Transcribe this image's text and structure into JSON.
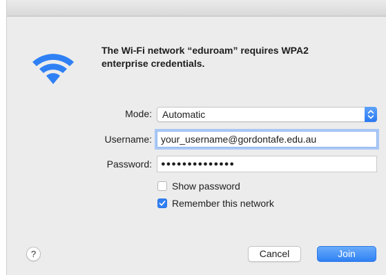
{
  "dialog": {
    "message": "The Wi-Fi network “eduroam” requires WPA2 enterprise credentials.",
    "icon": "wifi-icon",
    "accent_color": "#2f80f4"
  },
  "form": {
    "mode": {
      "label": "Mode:",
      "value": "Automatic"
    },
    "username": {
      "label": "Username:",
      "value": "your_username@gordontafe.edu.au"
    },
    "password": {
      "label": "Password:",
      "value": "●●●●●●●●●●●●●●"
    },
    "show_password": {
      "label": "Show password",
      "checked": false
    },
    "remember_network": {
      "label": "Remember this network",
      "checked": true
    }
  },
  "buttons": {
    "help": "?",
    "cancel": "Cancel",
    "join": "Join"
  }
}
